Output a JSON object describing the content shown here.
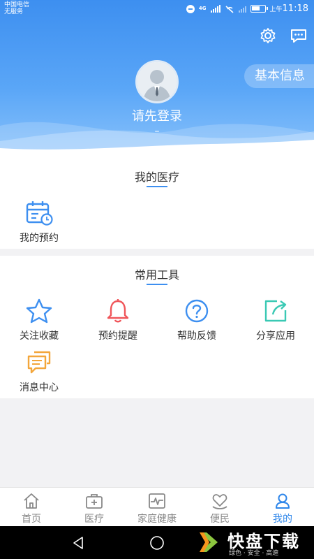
{
  "status_bar": {
    "carrier_line1": "中国电信",
    "carrier_line2": "无服务",
    "network": "4G",
    "time_prefix": "上午",
    "time": "11:18"
  },
  "header": {
    "login_prompt": "请先登录",
    "dash": "–",
    "basic_info_button": "基本信息"
  },
  "medical": {
    "title": "我的医疗",
    "items": [
      {
        "label": "我的预约",
        "icon": "calendar-clock-icon"
      }
    ]
  },
  "tools": {
    "title": "常用工具",
    "items": [
      {
        "label": "关注收藏",
        "icon": "star-icon"
      },
      {
        "label": "预约提醒",
        "icon": "bell-icon"
      },
      {
        "label": "帮助反馈",
        "icon": "question-icon"
      },
      {
        "label": "分享应用",
        "icon": "share-icon"
      },
      {
        "label": "消息中心",
        "icon": "message-icon"
      }
    ]
  },
  "bottom_nav": {
    "items": [
      {
        "label": "首页",
        "icon": "home-icon"
      },
      {
        "label": "医疗",
        "icon": "medical-kit-icon"
      },
      {
        "label": "家庭健康",
        "icon": "pulse-icon"
      },
      {
        "label": "便民",
        "icon": "heart-hand-icon"
      },
      {
        "label": "我的",
        "icon": "user-icon"
      }
    ],
    "active_index": 4
  },
  "watermark": {
    "main": "快盘下载",
    "sub": "绿色 · 安全 · 高速"
  },
  "colors": {
    "primary": "#3d8ff0",
    "active_nav": "#2e86ea",
    "star": "#3d8ff0",
    "bell": "#f0565a",
    "question": "#3d8ff0",
    "share": "#3ac9b4",
    "message": "#f3a63b"
  }
}
